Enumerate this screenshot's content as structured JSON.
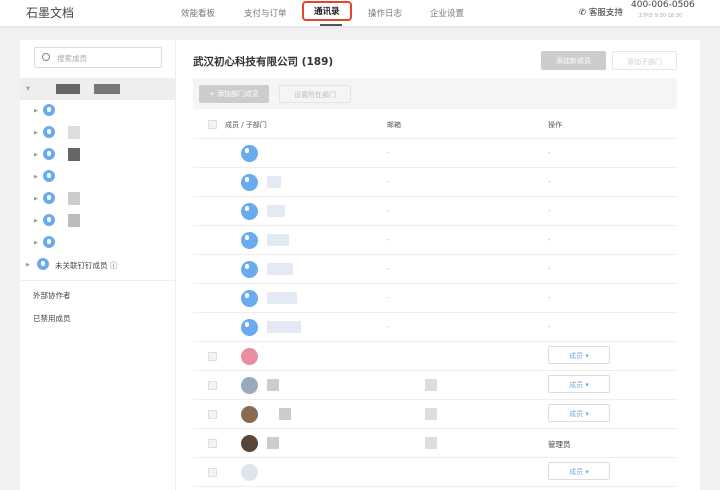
{
  "header": {
    "logo": "石墨文档",
    "nav": [
      "效能看板",
      "支付与订单",
      "通讯录",
      "操作日志",
      "企业设置"
    ],
    "active": "通讯录",
    "support_label": "客服支持",
    "phone": "400-006-0506",
    "hours": "工作日 9:30-18:30"
  },
  "sidebar": {
    "search_placeholder": "搜索成员",
    "unlinked_label": "未关联钉钉成员",
    "external_label": "外部协作者",
    "disabled_label": "已禁用成员"
  },
  "main": {
    "org_title": "武汉初心科技有限公司 (189)",
    "add_member": "添加新成员",
    "add_subdept": "添加子部门",
    "add_dept_member": "+ 添加部门成员",
    "set_dept": "设置所在部门",
    "columns": {
      "member": "成员 / 子部门",
      "email": "邮箱",
      "ops": "操作"
    },
    "dash": "-",
    "role_member": "成员 ▾",
    "role_admin": "管理员"
  },
  "colors": {
    "accent": "#e8432b",
    "avatar": "#6aabf0"
  }
}
